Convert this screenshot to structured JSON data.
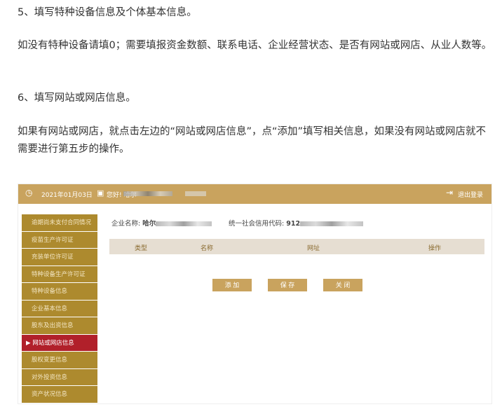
{
  "paragraphs": [
    "5、填写特种设备信息及个体基本信息。",
    "如没有特种设备请填0；需要填报资金数额、联系电话、企业经营状态、是否有网站或网店、从业人数等。",
    "6、填写网站或网店信息。",
    "如果有网站或网店，就点击左边的“网站或网店信息”，点“添加”填写相关信息，如果没有网站或网店就不需要进行第五步的操作。"
  ],
  "header": {
    "date": "2021年01月03日",
    "greeting": "您好! 哈尔",
    "logout": "退出登录"
  },
  "sidebar": [
    "逾期尚未支付合同情况",
    "疫苗生产许可证",
    "充装单位许可证",
    "特种设备生产许可证",
    "特种设备信息",
    "企业基本信息",
    "股东及出资信息",
    "网站或网店信息",
    "股权变更信息",
    "对外投资信息",
    "资产状况信息"
  ],
  "active_marker": "▶",
  "info": {
    "name_label": "企业名称:",
    "name_value": "哈尔",
    "code_label": "统一社会信用代码:",
    "code_value": "912"
  },
  "table": {
    "headers": [
      "类型",
      "名称",
      "网址",
      "操作"
    ]
  },
  "buttons": {
    "add": "添 加",
    "save": "保 存",
    "close": "关 闭"
  }
}
